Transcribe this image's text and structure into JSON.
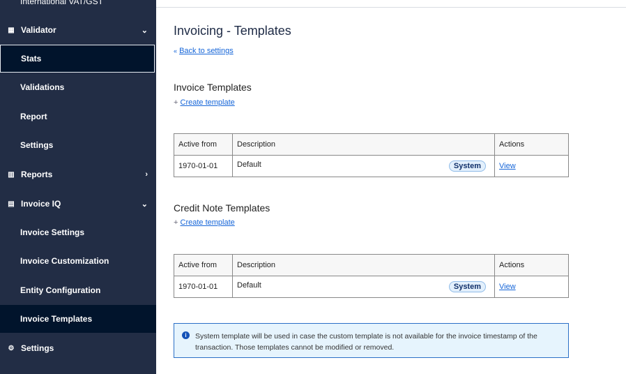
{
  "sidebar": {
    "items": [
      {
        "label": "International VAT/GST"
      },
      {
        "label": "Validator",
        "icon": "building-icon"
      },
      {
        "label": "Stats"
      },
      {
        "label": "Validations"
      },
      {
        "label": "Report"
      },
      {
        "label": "Settings"
      },
      {
        "label": "Reports",
        "icon": "chart-icon"
      },
      {
        "label": "Invoice IQ",
        "icon": "document-icon"
      },
      {
        "label": "Invoice Settings"
      },
      {
        "label": "Invoice Customization"
      },
      {
        "label": "Entity Configuration"
      },
      {
        "label": "Invoice Templates"
      },
      {
        "label": "Settings",
        "icon": "gear-icon"
      }
    ]
  },
  "main": {
    "title": "Invoicing - Templates",
    "back": "Back to settings",
    "invoice": {
      "heading": "Invoice Templates",
      "create": "Create template",
      "headers": [
        "Active from",
        "Description",
        "Actions"
      ],
      "rows": [
        {
          "date": "1970-01-01",
          "desc": "Default",
          "badge": "System",
          "action": "View"
        }
      ]
    },
    "credit": {
      "heading": "Credit Note Templates",
      "create": "Create template",
      "headers": [
        "Active from",
        "Description",
        "Actions"
      ],
      "rows": [
        {
          "date": "1970-01-01",
          "desc": "Default",
          "badge": "System",
          "action": "View"
        }
      ]
    },
    "note": "System template will be used in case the custom template is not available for the invoice timestamp of the transaction. Those templates cannot be modified or removed."
  }
}
